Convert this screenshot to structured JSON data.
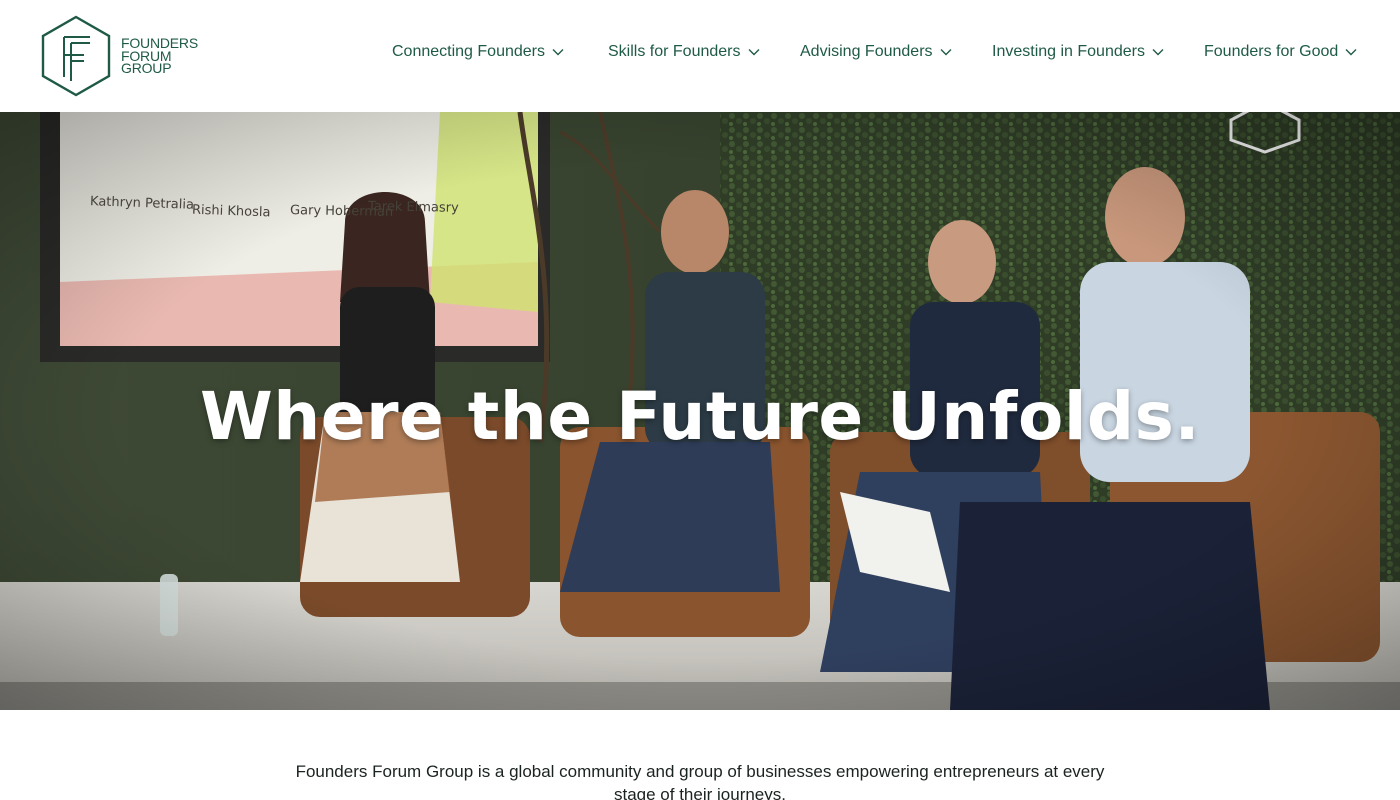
{
  "brand": {
    "name_lines": [
      "FOUNDERS",
      "FORUM",
      "GROUP"
    ],
    "color": "#1f5a47"
  },
  "nav": {
    "items": [
      {
        "label": "Connecting Founders",
        "icon": "chevron-down-icon"
      },
      {
        "label": "Skills for Founders",
        "icon": "chevron-down-icon"
      },
      {
        "label": "Advising Founders",
        "icon": "chevron-down-icon"
      },
      {
        "label": "Investing in Founders",
        "icon": "chevron-down-icon"
      },
      {
        "label": "Founders for Good",
        "icon": "chevron-down-icon"
      }
    ]
  },
  "hero": {
    "title": "Where the Future Unfolds.",
    "screen_names": [
      "Kathryn Petralia",
      "Rishi Khosla",
      "Gary Hoberman",
      "Tarek Elmasry"
    ]
  },
  "intro": {
    "text": "Founders Forum Group is a global community and group of businesses empowering entrepreneurs at every stage of their journeys."
  }
}
